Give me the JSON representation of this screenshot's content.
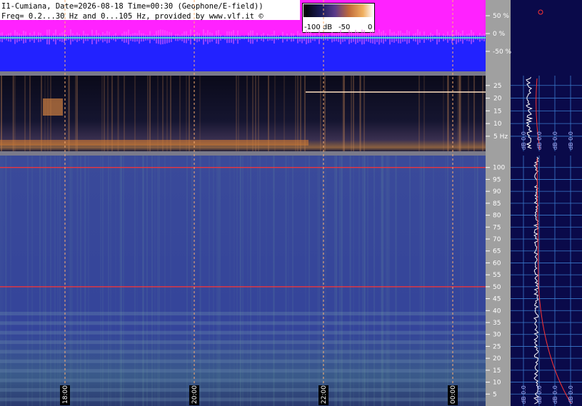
{
  "header": {
    "line1": "I1-Cumiana, Date=2026-08-18 Time=00:30 (Geophone/E-field))",
    "line2": "Freq= 0.2...30 Hz and 0...105 Hz, provided by www.vlf.it ©"
  },
  "colorbar": {
    "labels": [
      "-100 dB",
      "-50",
      "0"
    ]
  },
  "amplitude_axis": {
    "ticks": [
      "50 %",
      "0 %",
      "-50 %"
    ]
  },
  "low_freq_axis": {
    "ticks": [
      "25",
      "20",
      "15",
      "10",
      "5 Hz"
    ]
  },
  "high_freq_axis": {
    "ticks": [
      "100",
      "95",
      "90",
      "85",
      "80",
      "75",
      "70",
      "65",
      "60",
      "55",
      "50",
      "45",
      "40",
      "35",
      "30",
      "25",
      "20",
      "15",
      "10",
      "5"
    ]
  },
  "time_labels": [
    "18:00",
    "20:00",
    "22:00",
    "00:00"
  ],
  "right_labels_low": [
    "dB 0.0",
    "dB 0.0",
    "dB 0.0",
    "dB 0.0"
  ],
  "right_labels_high": [
    "dB 0.0",
    "dB 0.0",
    "dB 0.0",
    "dB 0.0"
  ],
  "chart_data": {
    "type": "heatmap",
    "title": "I1-Cumiana, Date=2026-08-18 Time=00:30 (Geophone/E-field))",
    "panels": [
      {
        "name": "amplitude",
        "ylim": [
          -100,
          100
        ],
        "yticks": [
          50,
          0,
          -50
        ]
      },
      {
        "name": "spectrogram 0.2-30 Hz",
        "ylim": [
          0.2,
          30
        ],
        "yticks": [
          25,
          20,
          15,
          10,
          5
        ]
      },
      {
        "name": "spectrogram 0-105 Hz",
        "ylim": [
          0,
          105
        ],
        "yticks": [
          100,
          95,
          90,
          85,
          80,
          75,
          70,
          65,
          60,
          55,
          50,
          45,
          40,
          35,
          30,
          25,
          20,
          15,
          10,
          5
        ]
      }
    ],
    "x": [
      "18:00",
      "20:00",
      "22:00",
      "00:00"
    ],
    "colorbar": {
      "min": -100,
      "max": 0,
      "unit": "dB"
    },
    "highlighted_lines_hz": [
      50,
      100
    ],
    "grid": true
  }
}
